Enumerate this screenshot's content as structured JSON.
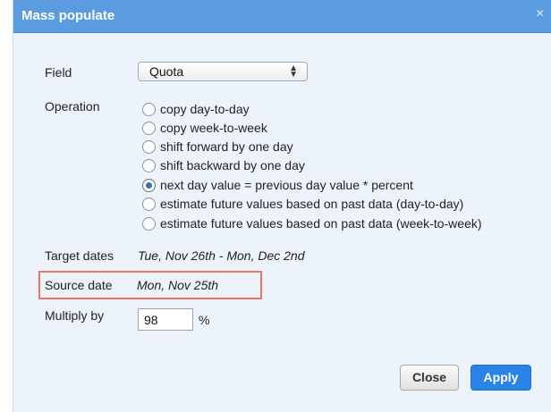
{
  "dialog": {
    "title": "Mass populate",
    "close_glyph": "×"
  },
  "field": {
    "label": "Field",
    "selected": "Quota",
    "arrows": "▲▼"
  },
  "operation": {
    "label": "Operation",
    "options": [
      {
        "label": "copy day-to-day",
        "checked": false
      },
      {
        "label": "copy week-to-week",
        "checked": false
      },
      {
        "label": "shift forward by one day",
        "checked": false
      },
      {
        "label": "shift backward by one day",
        "checked": false
      },
      {
        "label": "next day value = previous day value * percent",
        "checked": true
      },
      {
        "label": "estimate future values based on past data (day-to-day)",
        "checked": false
      },
      {
        "label": "estimate future values based on past data (week-to-week)",
        "checked": false
      }
    ]
  },
  "target_dates": {
    "label": "Target dates",
    "value": "Tue, Nov 26th - Mon, Dec 2nd"
  },
  "source_date": {
    "label": "Source date",
    "value": "Mon, Nov 25th"
  },
  "multiply": {
    "label": "Multiply by",
    "value": "98",
    "unit": "%"
  },
  "buttons": {
    "close": "Close",
    "apply": "Apply"
  },
  "colors": {
    "titlebar": "#5b9bdf",
    "apply": "#2a83e6",
    "highlight": "#e8785f",
    "background": "#edf3fb"
  }
}
